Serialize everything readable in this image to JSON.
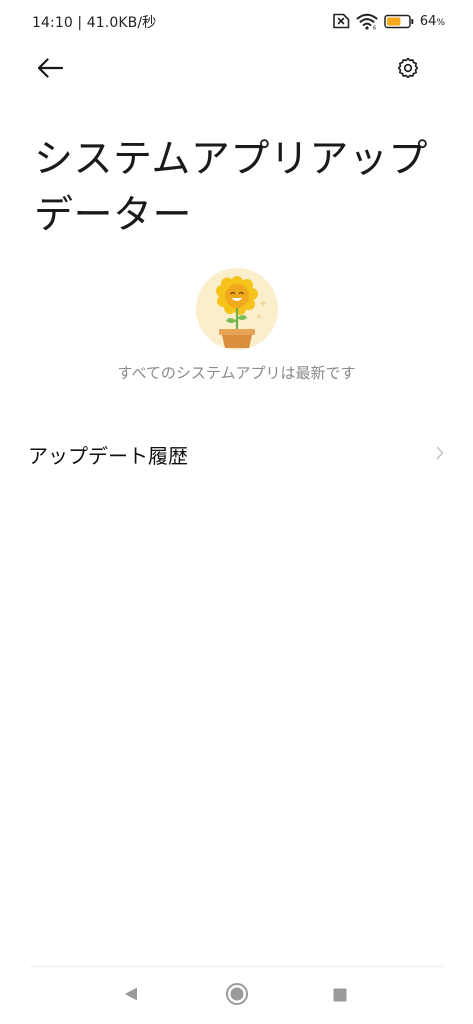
{
  "status_bar": {
    "time_speed": "14:10 | 41.0KB/秒",
    "battery_percent": "64",
    "battery_unit": "%",
    "battery_level": 0.64,
    "icons": [
      "sim-off-icon",
      "wifi-icon",
      "battery-icon"
    ]
  },
  "toolbar": {
    "back_icon": "back-arrow-icon",
    "settings_icon": "gear-icon"
  },
  "page": {
    "title": "システムアプリアップデーター",
    "status_message": "すべてのシステムアプリは最新です",
    "illustration_icon": "sunflower-pot-icon"
  },
  "history": {
    "label": "アップデート履歴",
    "chevron_icon": "chevron-right-icon"
  },
  "navigation": {
    "icons": [
      "back-triangle-icon",
      "home-circle-icon",
      "recents-square-icon"
    ]
  },
  "colors": {
    "battery_fill": "#f4a91a",
    "illustration_bg": "#fbeecb",
    "sunflower": "#f6c21c",
    "pot": "#d98f3d",
    "message_text": "#8a8a8a",
    "nav_icon": "#9a9a9a"
  }
}
